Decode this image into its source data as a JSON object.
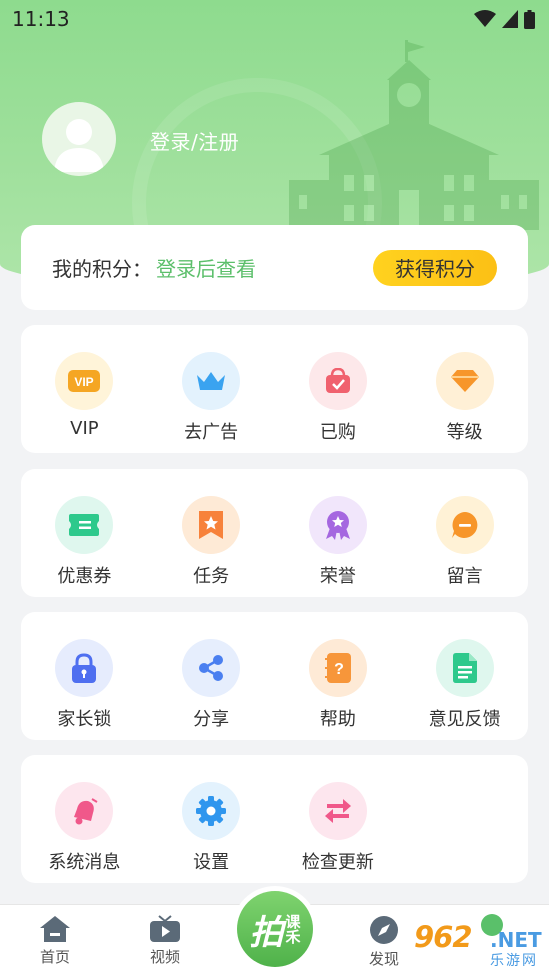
{
  "status_bar": {
    "time": "11:13"
  },
  "header": {
    "login_text": "登录/注册"
  },
  "points": {
    "label": "我的积分：",
    "value": "登录后查看",
    "earn_button": "获得积分"
  },
  "menu_rows": [
    [
      {
        "label": "VIP",
        "icon": "vip-icon",
        "bg": "#fff4d9"
      },
      {
        "label": "去广告",
        "icon": "crown-icon",
        "bg": "#e3f2fd"
      },
      {
        "label": "已购",
        "icon": "bag-icon",
        "bg": "#fde8ea"
      },
      {
        "label": "等级",
        "icon": "diamond-icon",
        "bg": "#fff0d6"
      }
    ],
    [
      {
        "label": "优惠券",
        "icon": "coupon-icon",
        "bg": "#dff7ee"
      },
      {
        "label": "任务",
        "icon": "task-icon",
        "bg": "#feead6"
      },
      {
        "label": "荣誉",
        "icon": "medal-icon",
        "bg": "#f1e6fb"
      },
      {
        "label": "留言",
        "icon": "message-icon",
        "bg": "#fff2d6"
      }
    ],
    [
      {
        "label": "家长锁",
        "icon": "lock-icon",
        "bg": "#e6ecfd"
      },
      {
        "label": "分享",
        "icon": "share-icon",
        "bg": "#e6eefd"
      },
      {
        "label": "帮助",
        "icon": "help-icon",
        "bg": "#feead6"
      },
      {
        "label": "意见反馈",
        "icon": "feedback-icon",
        "bg": "#dff7ee"
      }
    ],
    [
      {
        "label": "系统消息",
        "icon": "bell-icon",
        "bg": "#fde6ee"
      },
      {
        "label": "设置",
        "icon": "gear-icon",
        "bg": "#e3f2fd"
      },
      {
        "label": "检查更新",
        "icon": "refresh-icon",
        "bg": "#fde6ee"
      }
    ]
  ],
  "tabbar": {
    "home": "首页",
    "video": "视频",
    "discover": "发现",
    "center_big": "拍",
    "center_small": "课禾"
  },
  "watermark": {
    "number": "962",
    "domain": ".NET",
    "sub": "乐游网"
  },
  "colors": {
    "accent_green": "#5cbf6b",
    "earn_button": "#fcc81a",
    "header_green": "#8edb8e"
  }
}
